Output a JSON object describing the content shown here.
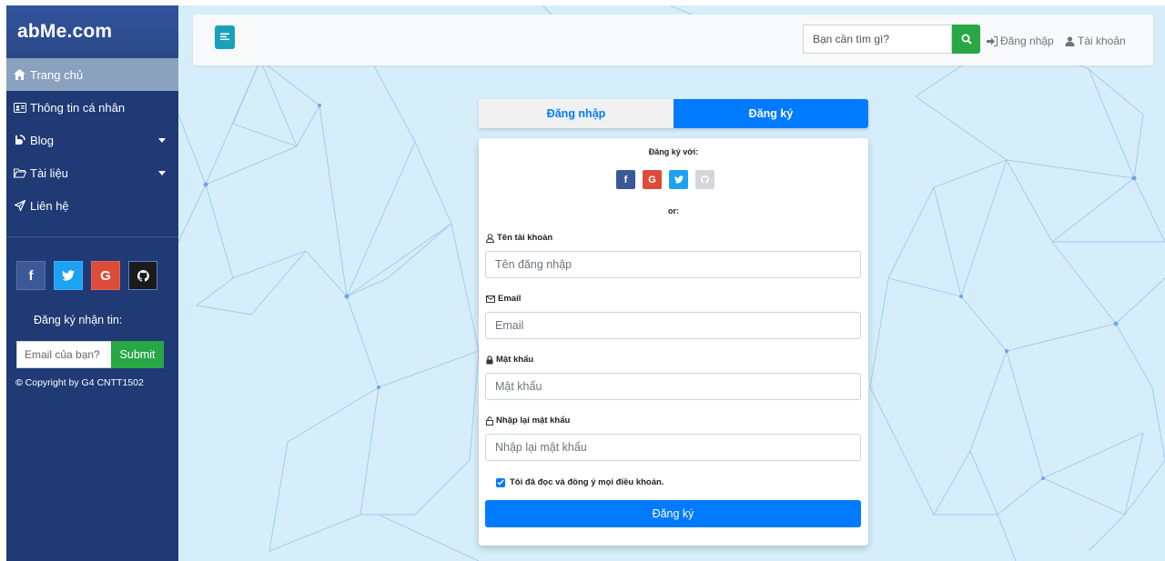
{
  "sidebar": {
    "brand": "abMe.com",
    "items": [
      {
        "label": "Trang chủ",
        "icon": "home-icon"
      },
      {
        "label": "Thông tin cá nhân",
        "icon": "id-card-icon"
      },
      {
        "label": "Blog",
        "icon": "blog-icon"
      },
      {
        "label": "Tài liệu",
        "icon": "folder-icon"
      },
      {
        "label": "Liên hệ",
        "icon": "send-icon"
      }
    ],
    "socials": {
      "facebook": "f",
      "google": "G"
    },
    "newsletter_title": "Đăng ký nhận tin:",
    "newsletter_placeholder": "Email của bạn?",
    "newsletter_submit": "Submit",
    "copyright": "Copyright by G4 CNTT1502"
  },
  "header": {
    "search_placeholder": "Bạn cần tìm gì?",
    "login_label": "Đăng nhập",
    "account_label": "Tài khoản"
  },
  "auth": {
    "tab_login": "Đăng nhập",
    "tab_register": "Đăng ký",
    "register_with": "Đăng ký với:",
    "or_label": "or:",
    "username_label": "Tên tài khoản",
    "username_placeholder": "Tên đăng nhập",
    "email_label": "Email",
    "email_placeholder": "Email",
    "password_label": "Mật khẩu",
    "password_placeholder": "Mật khẩu",
    "confirm_label": "Nhập lại mật khẩu",
    "confirm_placeholder": "Nhập lại mật khẩu",
    "agree_label": "Tôi đã đọc và đồng ý mọi điều khoản.",
    "submit_label": "Đăng ký",
    "social_fb": "f",
    "social_google": "G"
  },
  "colors": {
    "sidebar_bg": "#1f3a75",
    "active_item": "#8aa2bd",
    "primary": "#007bff",
    "success": "#28a745",
    "info": "#17a2b8",
    "main_bg": "#d6eefa"
  }
}
